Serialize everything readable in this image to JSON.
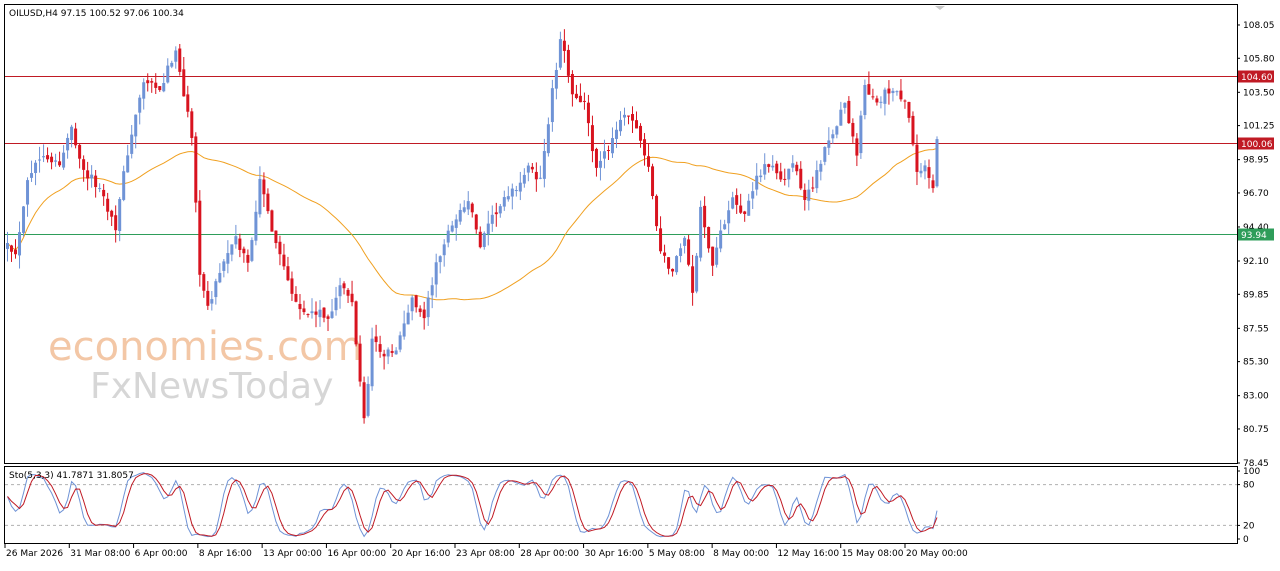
{
  "header": {
    "symbol_line": "OILUSD,H4  97.15 100.52 97.06 100.34",
    "stoch_line": "Sto(5,3,3) 41.7871 31.8057"
  },
  "watermark": {
    "line1": "economies.com",
    "line2": "FxNewsToday"
  },
  "colors": {
    "bull": "#6f93d6",
    "bear": "#d8131f",
    "ma": "#f0a020",
    "resistance": "#c01a24",
    "support": "#2e9d5a",
    "stoch_main": "#6f93d6",
    "stoch_signal": "#c01a24"
  },
  "chart_data": [
    {
      "type": "candlestick",
      "title": "OILUSD,H4",
      "ohlc_last": {
        "open": 97.15,
        "high": 100.52,
        "low": 97.06,
        "close": 100.34
      },
      "ylim": [
        78.45,
        109.4
      ],
      "y_ticks": [
        "108.05",
        "105.80",
        "103.50",
        "101.25",
        "98.95",
        "96.70",
        "94.40",
        "92.10",
        "89.85",
        "87.55",
        "85.30",
        "83.00",
        "80.75",
        "78.45"
      ],
      "x_ticks": [
        "26 Mar 2026",
        "31 Mar 08:00",
        "6 Apr 00:00",
        "8 Apr 16:00",
        "13 Apr 00:00",
        "16 Apr 00:00",
        "20 Apr 16:00",
        "23 Apr 08:00",
        "28 Apr 00:00",
        "30 Apr 16:00",
        "5 May 08:00",
        "8 May 00:00",
        "12 May 16:00",
        "15 May 08:00",
        "20 May 00:00"
      ],
      "levels": [
        {
          "value": 104.6,
          "label": "104.60",
          "role": "resistance"
        },
        {
          "value": 100.06,
          "label": "100.06",
          "role": "resistance"
        },
        {
          "value": 93.94,
          "label": "93.94",
          "role": "support"
        }
      ],
      "waypoints": [
        [
          0,
          93.6
        ],
        [
          2,
          92.5
        ],
        [
          5,
          97.8
        ],
        [
          9,
          99.5
        ],
        [
          13,
          98.5
        ],
        [
          16,
          101.2
        ],
        [
          19,
          98.2
        ],
        [
          23,
          97.0
        ],
        [
          27,
          94.5
        ],
        [
          30,
          99.5
        ],
        [
          34,
          104.2
        ],
        [
          38,
          103.5
        ],
        [
          42,
          106.5
        ],
        [
          45,
          102.0
        ],
        [
          46,
          100.4
        ],
        [
          48,
          91.5
        ],
        [
          50,
          88.8
        ],
        [
          53,
          91.5
        ],
        [
          57,
          93.5
        ],
        [
          60,
          92.0
        ],
        [
          63,
          97.4
        ],
        [
          66,
          94.4
        ],
        [
          68,
          92.6
        ],
        [
          71,
          90.2
        ],
        [
          74,
          88.5
        ],
        [
          77,
          88.6
        ],
        [
          80,
          88.2
        ],
        [
          83,
          90.5
        ],
        [
          86,
          89.2
        ],
        [
          89,
          81.4
        ],
        [
          91,
          86.8
        ],
        [
          94,
          85.8
        ],
        [
          97,
          86.0
        ],
        [
          101,
          89.6
        ],
        [
          104,
          88.3
        ],
        [
          107,
          91.8
        ],
        [
          111,
          94.7
        ],
        [
          115,
          96.2
        ],
        [
          118,
          93.1
        ],
        [
          122,
          95.5
        ],
        [
          126,
          96.7
        ],
        [
          130,
          98.3
        ],
        [
          133,
          97.6
        ],
        [
          136,
          103.5
        ],
        [
          138,
          106.8
        ],
        [
          139,
          106.0
        ],
        [
          141,
          103.6
        ],
        [
          144,
          102.7
        ],
        [
          147,
          98.1
        ],
        [
          150,
          99.8
        ],
        [
          153,
          101.8
        ],
        [
          157,
          101.3
        ],
        [
          160,
          98.2
        ],
        [
          161,
          96.5
        ],
        [
          163,
          92.7
        ],
        [
          166,
          91.4
        ],
        [
          169,
          93.9
        ],
        [
          171,
          89.7
        ],
        [
          173,
          95.6
        ],
        [
          176,
          92.0
        ],
        [
          178,
          93.9
        ],
        [
          181,
          96.7
        ],
        [
          184,
          95.0
        ],
        [
          187,
          97.8
        ],
        [
          190,
          98.8
        ],
        [
          193,
          97.3
        ],
        [
          196,
          98.7
        ],
        [
          199,
          96.2
        ],
        [
          202,
          98.0
        ],
        [
          205,
          100.2
        ],
        [
          209,
          102.8
        ],
        [
          212,
          99.4
        ],
        [
          214,
          104.0
        ],
        [
          217,
          102.5
        ],
        [
          219,
          103.5
        ],
        [
          223,
          103.3
        ],
        [
          225,
          101.8
        ],
        [
          227,
          97.8
        ],
        [
          229,
          98.4
        ],
        [
          231,
          97.2
        ],
        [
          232,
          100.34
        ]
      ],
      "ma_period": 50,
      "n_bars": 233
    },
    {
      "type": "line",
      "title": "Sto(5,3,3) 41.7871 31.8057",
      "series": [
        {
          "name": "Sto main",
          "last": 41.7871
        },
        {
          "name": "Sto signal",
          "last": 31.8057
        }
      ],
      "ylim": [
        0,
        100
      ],
      "y_ticks": [
        "100",
        "80",
        "20",
        "0"
      ],
      "levels": [
        80,
        20
      ]
    }
  ]
}
